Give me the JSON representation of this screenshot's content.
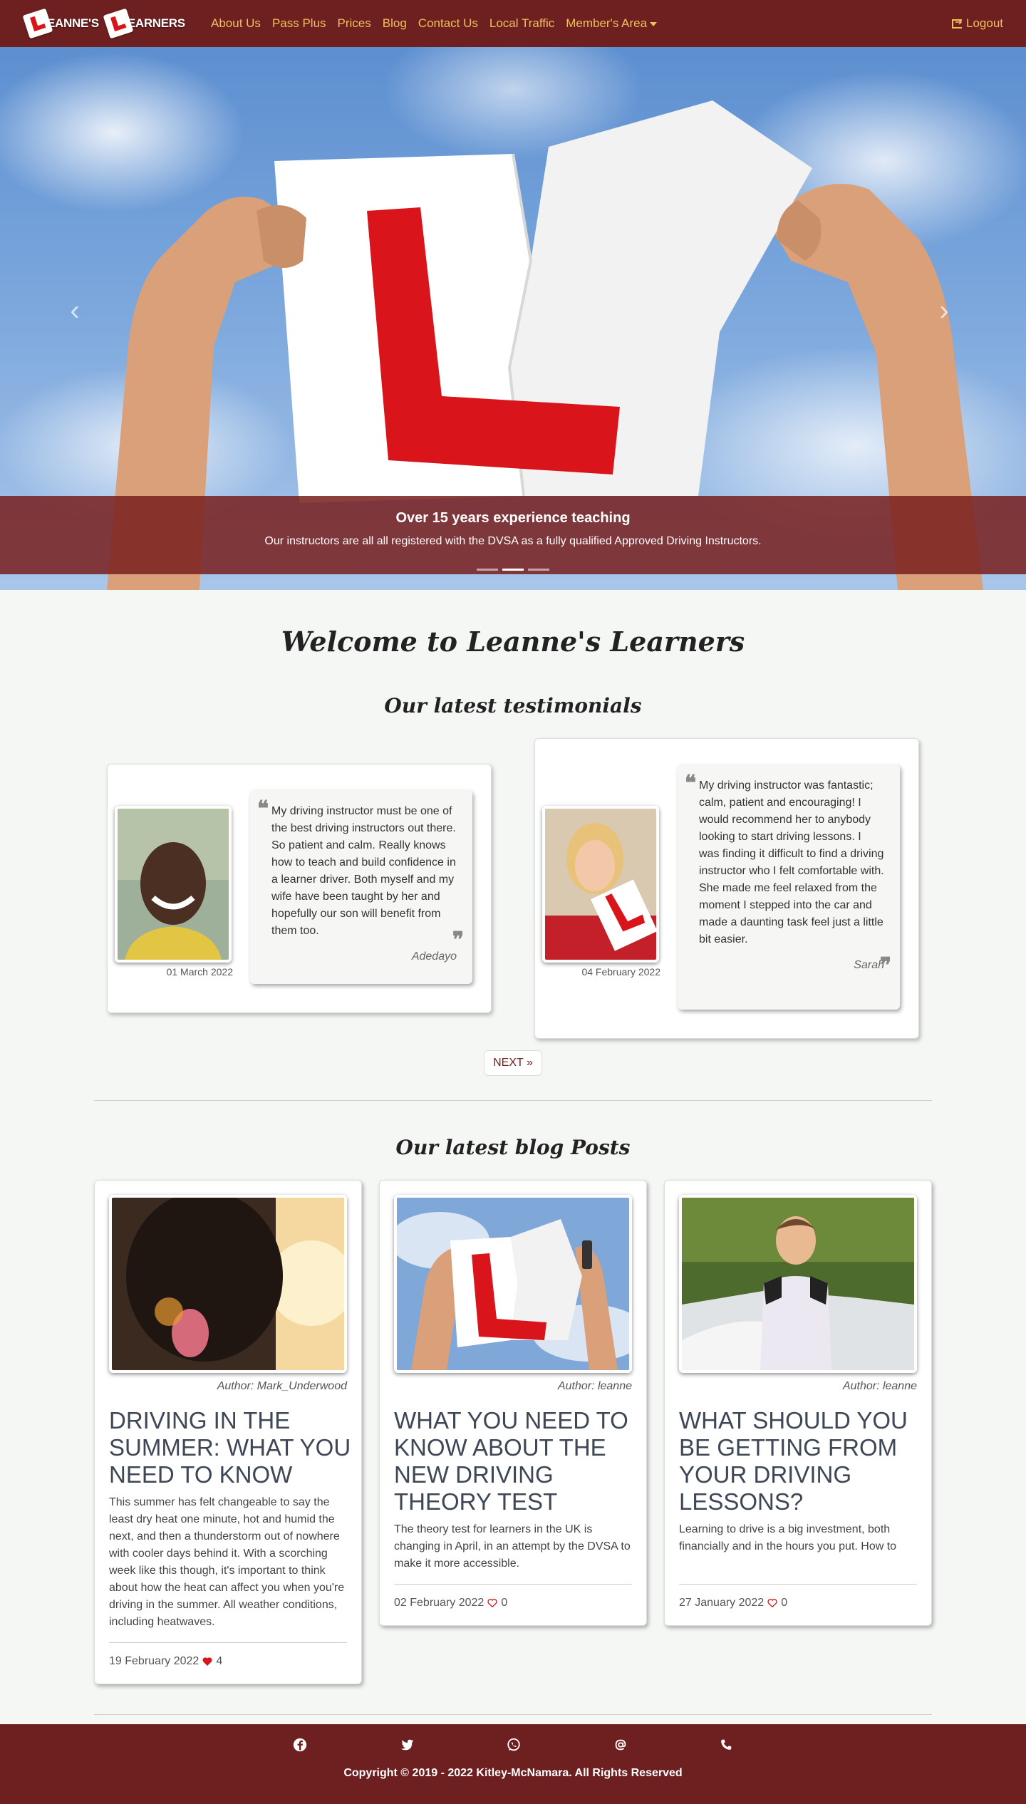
{
  "navbar": {
    "logo_word_1": "EANNE'S",
    "logo_word_2": "EARNERS",
    "links": [
      "About Us",
      "Pass Plus",
      "Prices",
      "Blog",
      "Contact Us",
      "Local Traffic",
      "Member's Area"
    ],
    "logout": "Logout"
  },
  "hero": {
    "caption_title": "Over 15 years experience teaching",
    "caption_text": "Our instructors are all all registered with the DVSA as a fully qualified Approved Driving Instructors.",
    "slides": 3,
    "active_slide": 2
  },
  "welcome": "Welcome to Leanne's Learners",
  "testimonials": {
    "title": "Our latest testimonials",
    "items": [
      {
        "date": "01 March 2022",
        "text": "My driving instructor must be one of the best driving instructors out there. So patient and calm. Really knows how to teach and build confidence in a learner driver. Both myself and my wife have been taught by her and hopefully our son will benefit from them too.",
        "author": "Adedayo"
      },
      {
        "date": "04 February 2022",
        "text": "My driving instructor was fantastic; calm, patient and encouraging! I would recommend her to anybody looking to start driving lessons. I was finding it difficult to find a driving instructor who I felt comfortable with. She made me feel relaxed from the moment I stepped into the car and made a daunting task feel just a little bit easier.",
        "author": "Sarah"
      }
    ],
    "next": "NEXT »"
  },
  "blog": {
    "title": "Our latest blog Posts",
    "posts": [
      {
        "author": "Author: Mark_Underwood",
        "title": "DRIVING IN THE SUMMER: WHAT YOU NEED TO KNOW",
        "excerpt": "This summer has felt changeable to say the least dry heat one minute, hot and humid the next, and then a thunderstorm out of nowhere with cooler days behind it. With a scorching week like this though, it's important to think about how the heat can affect you when you're driving in the summer. All weather conditions, including heatwaves.",
        "date": "19 February 2022",
        "likes": "4",
        "liked": true
      },
      {
        "author": "Author: leanne",
        "title": "WHAT YOU NEED TO KNOW ABOUT THE NEW DRIVING THEORY TEST",
        "excerpt": "The theory test for learners in the UK is changing in April, in an attempt by the DVSA to make it more accessible.",
        "date": "02 February 2022",
        "likes": "0",
        "liked": false
      },
      {
        "author": "Author: leanne",
        "title": "WHAT SHOULD YOU BE GETTING FROM YOUR DRIVING LESSONS?",
        "excerpt": "Learning to drive is a big investment, both financially and in the hours you put. How to ensure you're getting good value for money",
        "date": "27 January 2022",
        "likes": "0",
        "liked": false
      }
    ]
  },
  "footer": {
    "icons": [
      "facebook-icon",
      "twitter-icon",
      "whatsapp-icon",
      "email-icon",
      "phone-icon"
    ],
    "copyright": "Copyright © 2019 - 2022   Kitley-McNamara.   All Rights Reserved"
  },
  "colors": {
    "brand": "#6e1f1f",
    "nav_link": "#f0c05a",
    "l_plate_red": "#d9141b"
  }
}
